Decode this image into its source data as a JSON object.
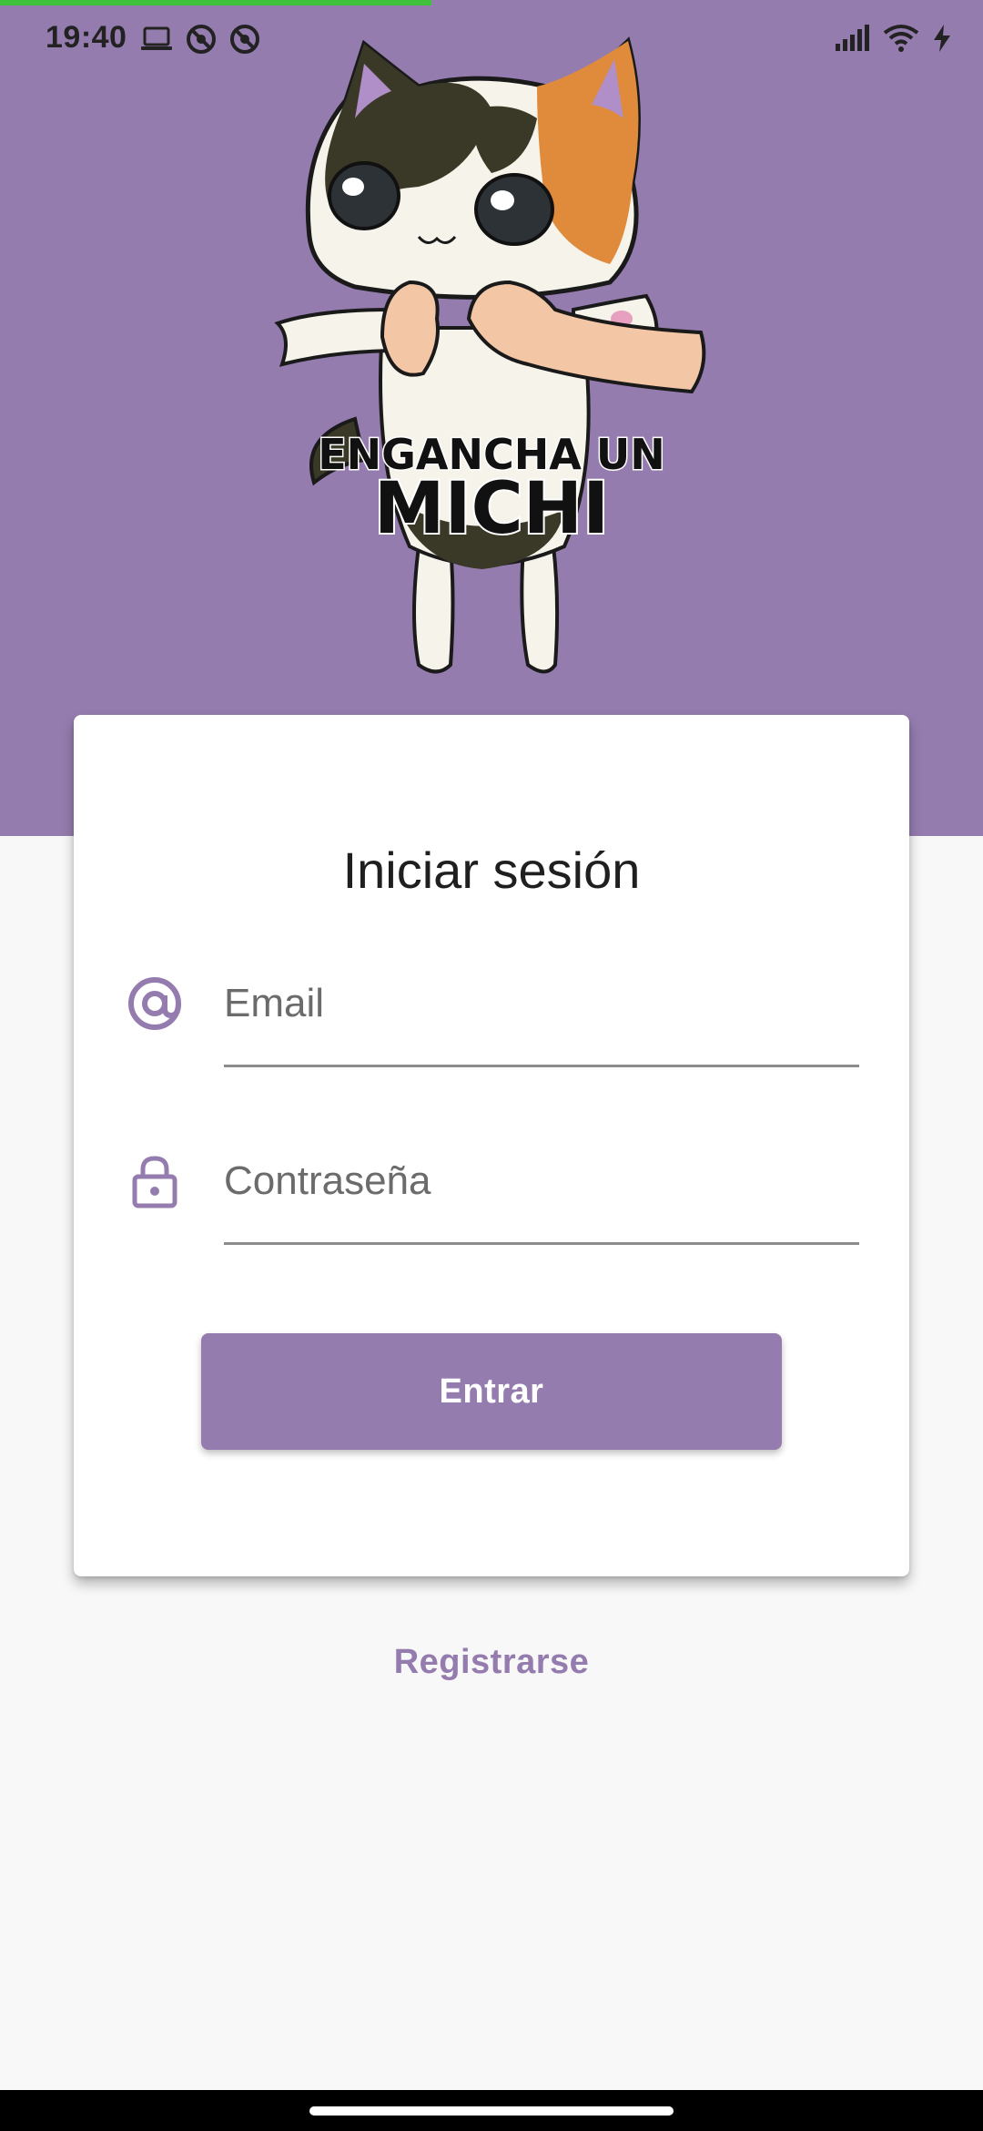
{
  "status_bar": {
    "time": "19:40",
    "left_icons": [
      "laptop-icon",
      "no-disturb-icon",
      "no-disturb-icon"
    ],
    "right_icons": [
      "signal-icon",
      "wifi-icon",
      "charging-icon"
    ]
  },
  "header": {
    "logo_line1": "ENGANCHA UN",
    "logo_line2": "MICHI",
    "background_color": "#957caf"
  },
  "login_card": {
    "title": "Iniciar sesión",
    "email_placeholder": "Email",
    "email_icon": "at-icon",
    "password_placeholder": "Contraseña",
    "password_icon": "lock-icon",
    "submit_label": "Entrar"
  },
  "register_link": "Registrarse",
  "colors": {
    "accent": "#957caf",
    "progress": "#3fc13a"
  }
}
